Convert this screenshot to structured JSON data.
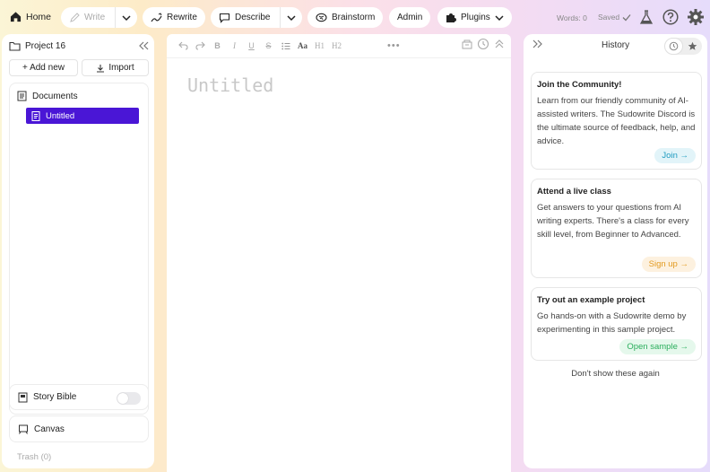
{
  "topbar": {
    "home": "Home",
    "write": "Write",
    "rewrite": "Rewrite",
    "describe": "Describe",
    "brainstorm": "Brainstorm",
    "admin": "Admin",
    "plugins": "Plugins",
    "words": "Words: 0",
    "saved": "Saved"
  },
  "left_panel": {
    "project": "Project 16",
    "add_new": "+ Add new",
    "import": "Import",
    "documents_label": "Documents",
    "documents": [
      {
        "title": "Untitled",
        "selected": true
      }
    ],
    "story_bible": "Story Bible",
    "story_bible_on": false,
    "canvas": "Canvas",
    "trash": "Trash (0)"
  },
  "editor": {
    "toolbar": [
      "undo",
      "redo",
      "B",
      "I",
      "U",
      "S",
      "list",
      "Aa",
      "H1",
      "H2"
    ],
    "doc_title_placeholder": "Untitled"
  },
  "right_panel": {
    "title": "History",
    "cards": [
      {
        "title": "Join the Community!",
        "body": "Learn from our friendly community of AI-assisted writers. The Sudowrite Discord is the ultimate source of feedback, help, and advice.",
        "cta": "Join →"
      },
      {
        "title": "Attend a live class",
        "body": "Get answers to your questions from AI writing experts. There's a class for every skill level, from Beginner to Advanced.",
        "cta": "Sign up →"
      },
      {
        "title": "Try out an example project",
        "body": "Go hands-on with a Sudowrite demo by experimenting in this sample project.",
        "cta": "Open sample →"
      }
    ],
    "dismiss": "Don't show these again"
  },
  "colors": {
    "accent": "#4a16d6",
    "join": "#1e9bc0",
    "signup": "#e39a1f",
    "sample": "#2aae5c"
  }
}
